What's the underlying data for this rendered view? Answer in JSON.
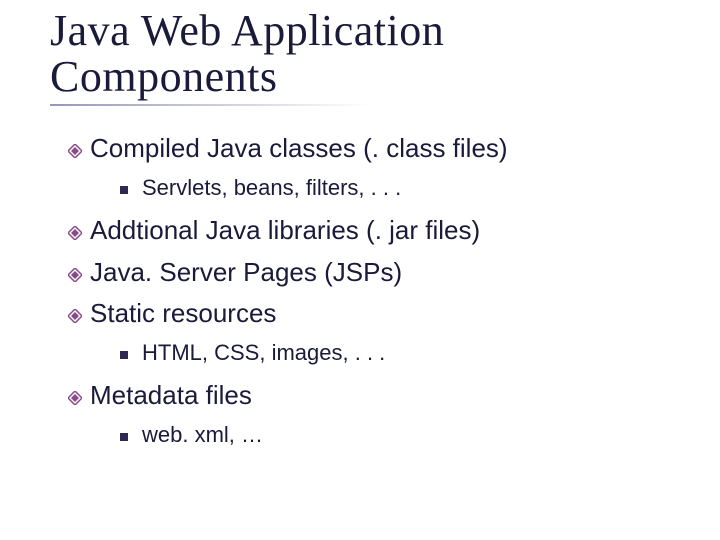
{
  "title_line1": "Java Web Application",
  "title_line2": "Components",
  "items": [
    {
      "text": "Compiled Java classes (. class files)",
      "level": 1
    },
    {
      "text": "Servlets, beans, filters, . . .",
      "level": 2
    },
    {
      "text": "Addtional Java libraries (. jar files)",
      "level": 1
    },
    {
      "text": "Java. Server Pages (JSPs)",
      "level": 1
    },
    {
      "text": "Static resources",
      "level": 1
    },
    {
      "text": "HTML, CSS, images, . . .",
      "level": 2
    },
    {
      "text": "Metadata files",
      "level": 1
    },
    {
      "text": "web. xml, …",
      "level": 2
    }
  ]
}
